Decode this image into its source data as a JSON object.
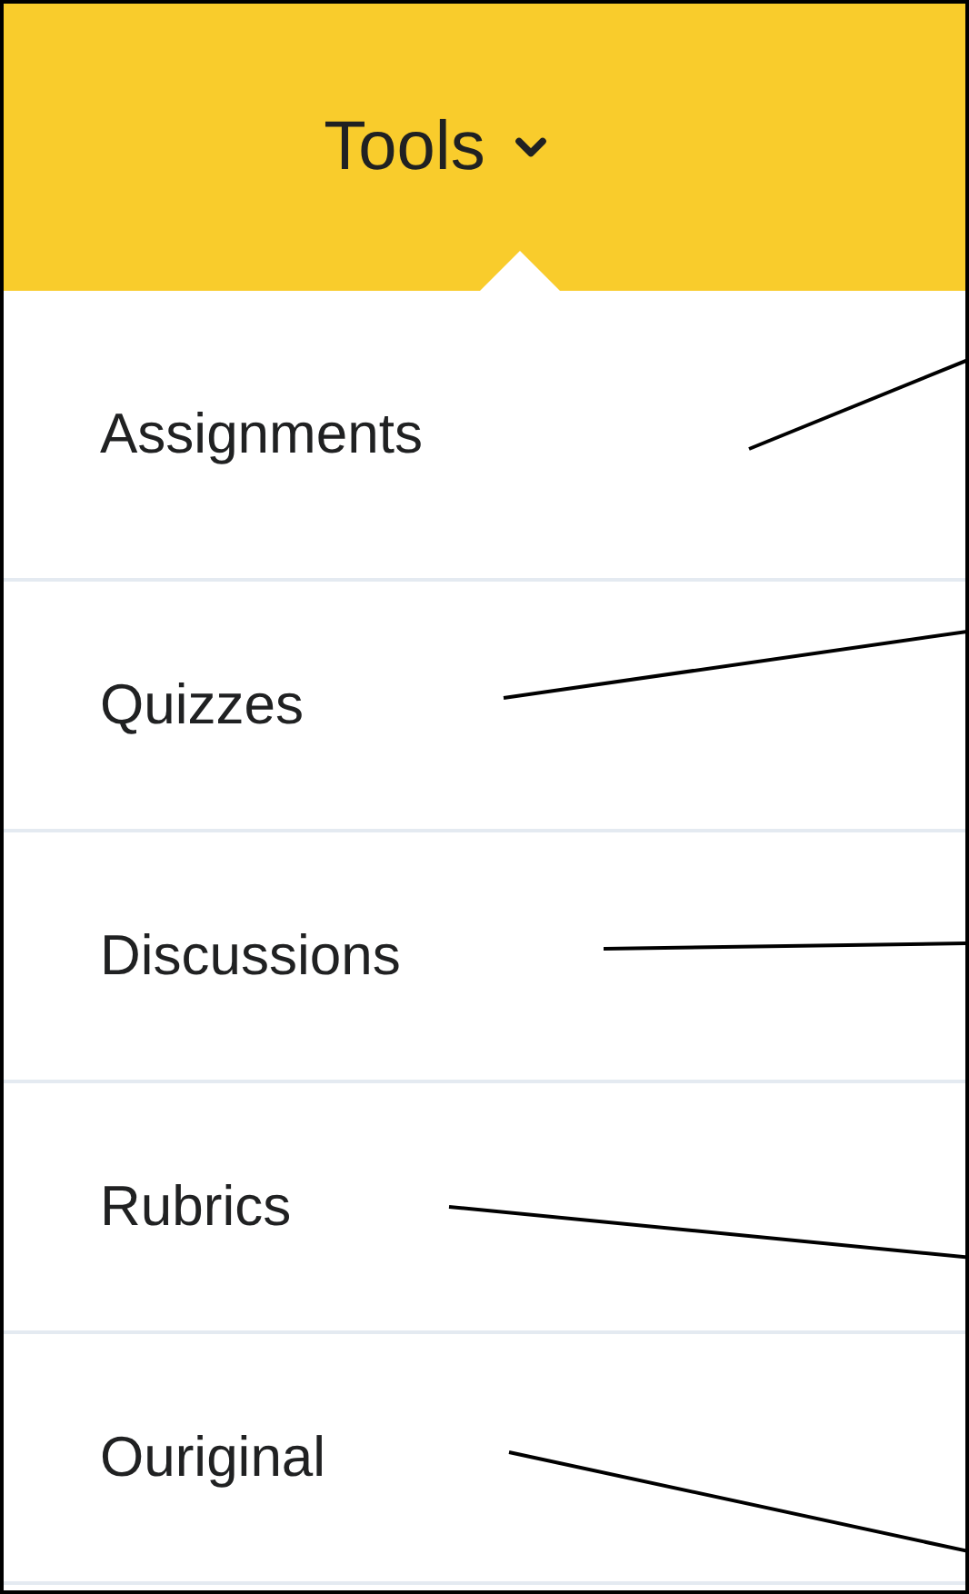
{
  "menu_button": {
    "label": "Tools",
    "expanded": true
  },
  "items": [
    {
      "label": "Assignments"
    },
    {
      "label": "Quizzes"
    },
    {
      "label": "Discussions"
    },
    {
      "label": "Rubrics"
    },
    {
      "label": "Ouriginal"
    }
  ]
}
